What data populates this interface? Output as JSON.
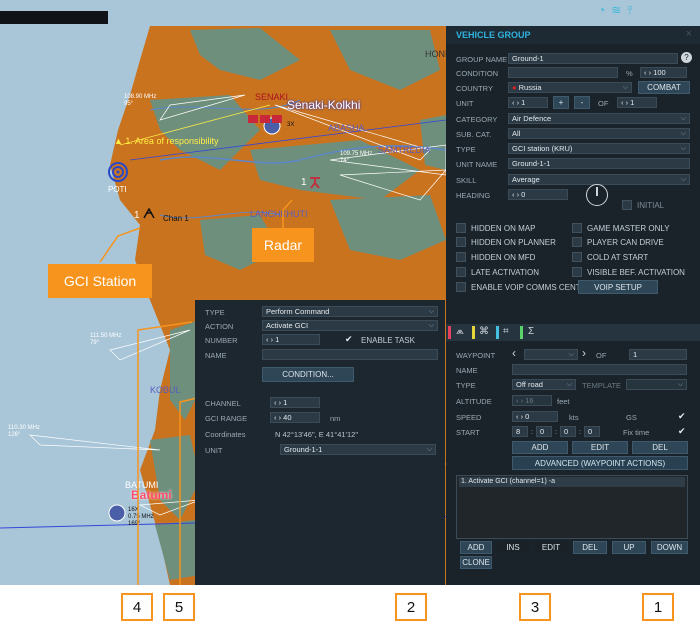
{
  "map": {
    "labels": {
      "honi": "HONI",
      "senaki": "SENAKI",
      "senaki_kolkhi": "Senaki-Kolkhi",
      "abasha": "ABASHA",
      "samtredia": "SAMTREDIA",
      "area_of_responsibility": "1. Area of responsibility",
      "poti": "POTI",
      "chan1": "Chan 1",
      "lanchkhuti": "LANCHKHUTI",
      "kobuleti": "KOBUL",
      "batumi_small": "BATUMI",
      "batumi": "Batumi",
      "unit_num_1": "1",
      "unit_num_radar": "1",
      "unit_label_3x": "3X",
      "freq_senaki": "108.90 MHz\n95°",
      "freq_samtredia": "109.75 MHz\n74°",
      "freq_kobuleti": "111.50 MHz\n79°",
      "freq_batumi_sea": "110.30 MHz\n126°",
      "freq_batumi_ap": "16X\n0.75 MHz\n169°"
    }
  },
  "callouts": {
    "gci_station": "GCI Station",
    "radar": "Radar"
  },
  "markers": [
    "1",
    "2",
    "3",
    "4",
    "5"
  ],
  "vehicle_group": {
    "title": "VEHICLE GROUP",
    "close": "×",
    "group_name_label": "GROUP NAME",
    "group_name": "Ground-1",
    "help": "?",
    "condition_label": "CONDITION",
    "condition_value": "",
    "percent": "%",
    "percent_value": "100",
    "country_label": "COUNTRY",
    "country": "Russia",
    "combat": "COMBAT",
    "unit_label": "UNIT",
    "unit_value": "1",
    "plus": "+",
    "minus": "-",
    "of": "OF",
    "of_value": "1",
    "category_label": "CATEGORY",
    "category": "Air Defence",
    "subcat_label": "SUB. CAT.",
    "subcat": "All",
    "type_label": "TYPE",
    "type": "GCI station (KRU)",
    "unitname_label": "UNIT NAME",
    "unitname": "Ground-1-1",
    "skill_label": "SKILL",
    "skill": "Average",
    "heading_label": "HEADING",
    "heading": "0",
    "initial": "INITIAL",
    "checkboxes": [
      "HIDDEN ON MAP",
      "GAME MASTER ONLY",
      "HIDDEN ON PLANNER",
      "PLAYER CAN DRIVE",
      "HIDDEN ON MFD",
      "COLD AT START",
      "LATE ACTIVATION",
      "VISIBLE BEF. ACTIVATION",
      "ENABLE VOIP COMMS CENTER"
    ],
    "voip_setup": "VOIP SETUP"
  },
  "waypoint": {
    "tab_icons": [
      "route-icon",
      "target-icon",
      "triggered-icon",
      "summary-icon"
    ],
    "tab_sigma": "Σ",
    "waypoint_label": "WAYPOINT",
    "of": "OF",
    "of_value": "1",
    "name_label": "NAME",
    "type_label": "TYPE",
    "type": "Off road",
    "template_label": "TEMPLATE",
    "altitude_label": "ALTITUDE",
    "altitude": "16",
    "feet": "feet",
    "speed_label": "SPEED",
    "speed": "0",
    "kts": "kts",
    "gs": "GS",
    "start_label": "START",
    "start": [
      "8",
      "0",
      "0",
      "0"
    ],
    "fix_time": "Fix time",
    "add": "ADD",
    "edit": "EDIT",
    "del": "DEL",
    "advanced": "ADVANCED (WAYPOINT ACTIONS)",
    "action_item": "1. Activate GCI (channel=1) -a",
    "buttons": [
      "ADD",
      "INS",
      "EDIT",
      "DEL",
      "UP",
      "DOWN"
    ],
    "clone": "CLONE"
  },
  "action_panel": {
    "type_label": "TYPE",
    "type": "Perform Command",
    "action_label": "ACTION",
    "action": "Activate GCI",
    "number_label": "NUMBER",
    "number": "1",
    "enable_task": "ENABLE TASK",
    "name_label": "NAME",
    "condition": "CONDITION...",
    "channel_label": "CHANNEL",
    "channel": "1",
    "gci_range_label": "GCI RANGE",
    "gci_range": "40",
    "nm": "nm",
    "coordinates_label": "Coordinates",
    "coordinates": "N 42°13'46\", E 41°41'12\"",
    "unit_label": "UNIT",
    "unit": "Ground-1-1"
  },
  "colors": {
    "sea": "#a9c5d6",
    "land": "#c9731f",
    "land_green": "#6f8f7d",
    "panel": "#1e2a33",
    "accent": "#f7941d",
    "title": "#2fb3df"
  }
}
